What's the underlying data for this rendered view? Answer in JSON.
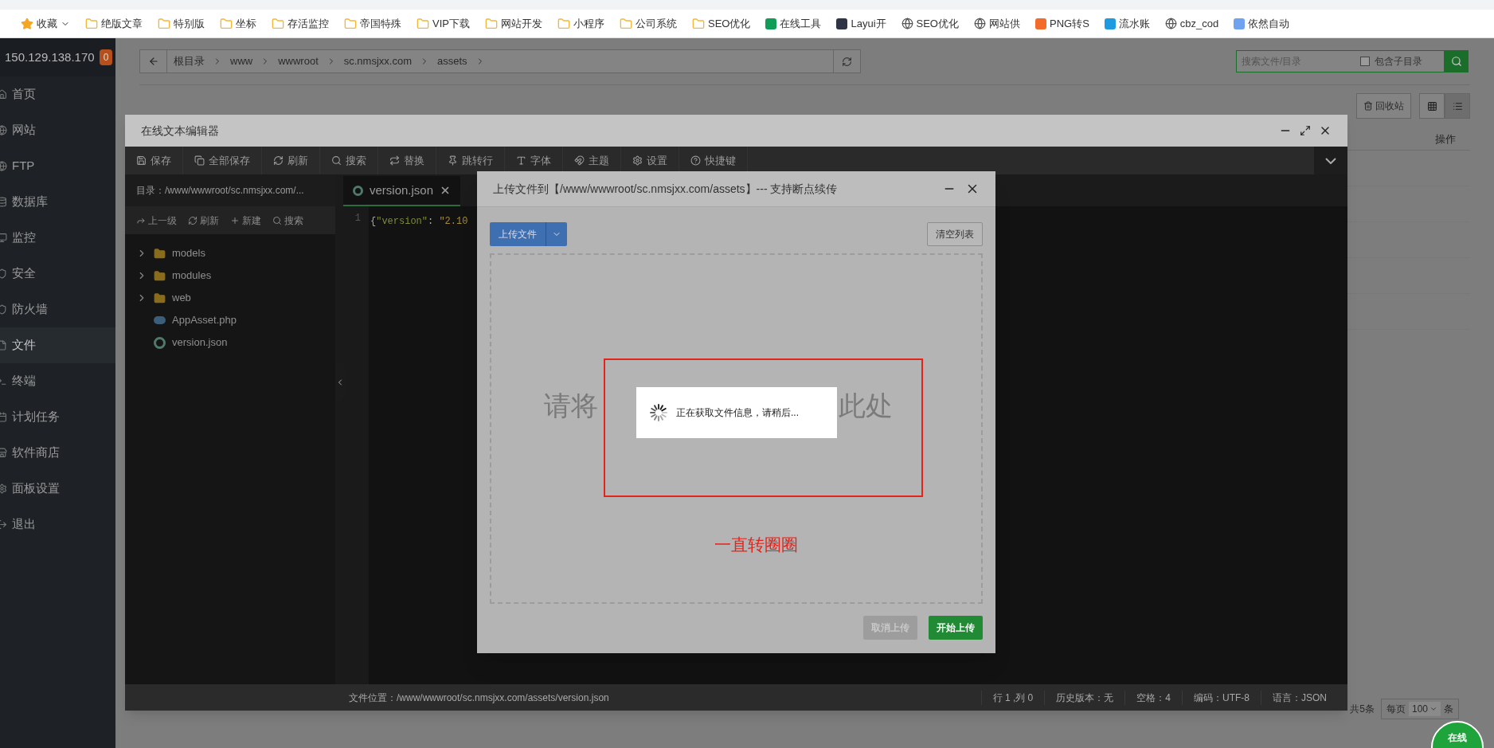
{
  "bookmarks": [
    {
      "label": "收藏",
      "kind": "star"
    },
    {
      "label": "绝版文章",
      "kind": "folder"
    },
    {
      "label": "特别版",
      "kind": "folder"
    },
    {
      "label": "坐标",
      "kind": "folder"
    },
    {
      "label": "存活监控",
      "kind": "folder"
    },
    {
      "label": "帝国特殊",
      "kind": "folder"
    },
    {
      "label": "VIP下载",
      "kind": "folder"
    },
    {
      "label": "网站开发",
      "kind": "folder"
    },
    {
      "label": "小程序",
      "kind": "folder"
    },
    {
      "label": "公司系统",
      "kind": "folder"
    },
    {
      "label": "SEO优化",
      "kind": "folder"
    },
    {
      "label": "在线工具",
      "kind": "site",
      "color": "#0f9d58"
    },
    {
      "label": "Layui开",
      "kind": "site",
      "color": "#2f3545"
    },
    {
      "label": "SEO优化",
      "kind": "globe"
    },
    {
      "label": "网站供",
      "kind": "globe"
    },
    {
      "label": "PNG转S",
      "kind": "site",
      "color": "#f26b2b"
    },
    {
      "label": "流水账",
      "kind": "site",
      "color": "#1e9be0"
    },
    {
      "label": "cbz_cod",
      "kind": "globe"
    },
    {
      "label": "依然自动",
      "kind": "site",
      "color": "#6fa3f0"
    }
  ],
  "sidebar": {
    "ip": "150.129.138.170",
    "badge": "0",
    "items": [
      {
        "label": "首页",
        "selected": false
      },
      {
        "label": "网站",
        "selected": false
      },
      {
        "label": "FTP",
        "selected": false
      },
      {
        "label": "数据库",
        "selected": false
      },
      {
        "label": "监控",
        "selected": false
      },
      {
        "label": "安全",
        "selected": false
      },
      {
        "label": "防火墙",
        "selected": false
      },
      {
        "label": "文件",
        "selected": true
      },
      {
        "label": "终端",
        "selected": false
      },
      {
        "label": "计划任务",
        "selected": false
      },
      {
        "label": "软件商店",
        "selected": false
      },
      {
        "label": "面板设置",
        "selected": false
      },
      {
        "label": "退出",
        "selected": false
      }
    ]
  },
  "breadcrumb": [
    "根目录",
    "www",
    "wwwroot",
    "sc.nmsjxx.com",
    "assets"
  ],
  "search": {
    "placeholder": "搜索文件/目录",
    "include_sub": {
      "label": "包含子目录",
      "checked": false
    }
  },
  "recycle_button": "回收站",
  "table_header": "操作",
  "pagination": {
    "total": "共5条",
    "per_page_label": "每页",
    "per_page": "100",
    "unit": "条"
  },
  "chat_badge": "在线",
  "editor": {
    "title": "在线文本编辑器",
    "toolbar": [
      "保存",
      "全部保存",
      "刷新",
      "搜索",
      "替换",
      "跳转行",
      "字体",
      "主题",
      "设置",
      "快捷键"
    ],
    "dir": "目录：/www/wwwroot/sc.nmsjxx.com/...",
    "tree_actions": [
      "上一级",
      "刷新",
      "新建",
      "搜索"
    ],
    "tree": [
      {
        "name": "models",
        "kind": "folder",
        "expanded": false
      },
      {
        "name": "modules",
        "kind": "folder",
        "expanded": false
      },
      {
        "name": "web",
        "kind": "folder",
        "expanded": false
      },
      {
        "name": "AppAsset.php",
        "kind": "php"
      },
      {
        "name": "version.json",
        "kind": "json"
      }
    ],
    "tab": "version.json",
    "line_number": "1",
    "code": [
      {
        "text": "{",
        "kind": "punct"
      },
      {
        "text": "\"version\"",
        "kind": "key"
      },
      {
        "text": ": ",
        "kind": "punct"
      },
      {
        "text": "\"2.10",
        "kind": "string"
      }
    ],
    "status": {
      "path": "文件位置：/www/wwwroot/sc.nmsjxx.com/assets/version.json",
      "items": [
        "行 1 ,列 0",
        "历史版本：无",
        "空格：4",
        "编码：UTF-8",
        "语言：JSON"
      ]
    }
  },
  "upload": {
    "title": "上传文件到【/www/wwwroot/sc.nmsjxx.com/assets】--- 支持断点续传",
    "upload_button": "上传文件",
    "clear_button": "清空列表",
    "hint_left": "请将",
    "hint_right": "此处",
    "loading": "正在获取文件信息，请稍后...",
    "cancel": {
      "label": "取消上传",
      "disabled": true
    },
    "start": {
      "label": "开始上传",
      "disabled": false
    },
    "annotation": "一直转圈圈"
  }
}
